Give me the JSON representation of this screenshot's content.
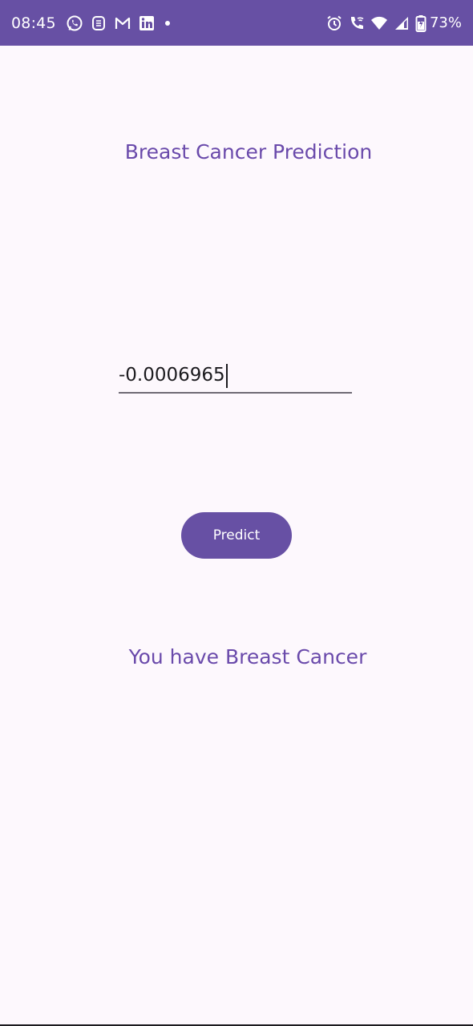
{
  "status_bar": {
    "time": "08:45",
    "battery": "73%",
    "icons_left": [
      "whatsapp-icon",
      "sim-toolkit-icon",
      "gmail-icon",
      "linkedin-icon",
      "notification-dot-icon"
    ],
    "icons_right": [
      "alarm-icon",
      "wifi-calling-icon",
      "wifi-icon",
      "signal-icon",
      "battery-icon"
    ],
    "background_color": "#6750a4"
  },
  "main": {
    "title": "Breast Cancer Prediction",
    "input_value": "-0.0006965",
    "predict_label": "Predict",
    "result_text": "You have Breast Cancer",
    "accent_color": "#6750a4"
  }
}
